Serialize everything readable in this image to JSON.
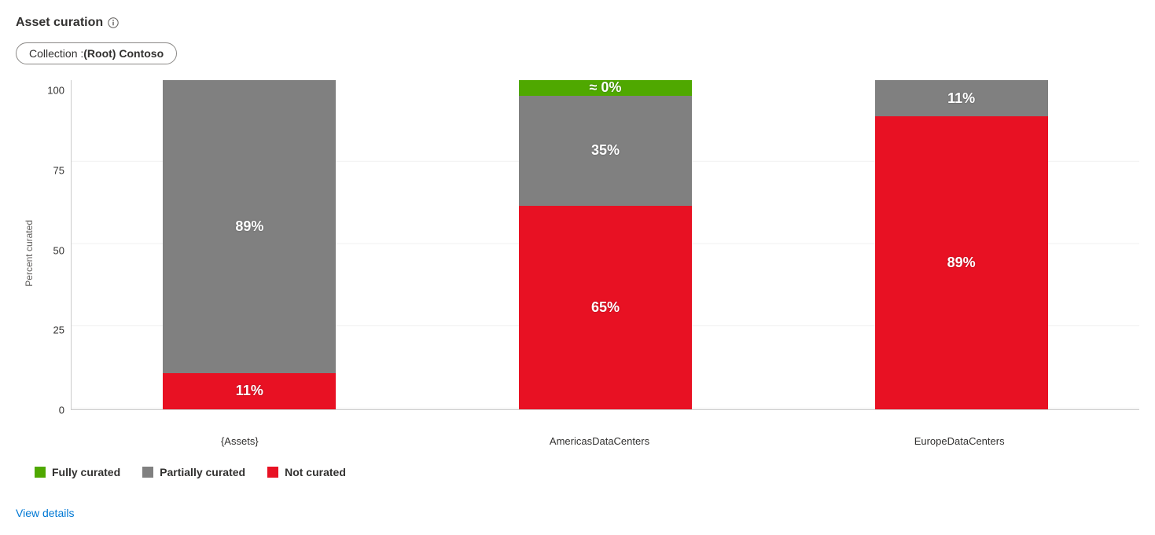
{
  "header": {
    "title": "Asset curation"
  },
  "filter": {
    "label": "Collection : ",
    "value": "(Root) Contoso"
  },
  "chart_data": {
    "type": "bar",
    "stacked": true,
    "ylabel": "Percent curated",
    "ylim": [
      0,
      100
    ],
    "yticks": [
      0,
      25,
      50,
      75,
      100
    ],
    "categories": [
      "{Assets}",
      "AmericasDataCenters",
      "EuropeDataCenters"
    ],
    "series": [
      {
        "name": "Fully curated",
        "color": "#4fa800",
        "values": [
          0,
          0.1,
          0
        ],
        "labels": [
          "",
          "≈ 0%",
          ""
        ]
      },
      {
        "name": "Partially curated",
        "color": "#808080",
        "values": [
          89,
          35,
          11
        ],
        "labels": [
          "89%",
          "35%",
          "11%"
        ]
      },
      {
        "name": "Not curated",
        "color": "#e81123",
        "values": [
          11,
          65,
          89
        ],
        "labels": [
          "11%",
          "65%",
          "89%"
        ]
      }
    ]
  },
  "legend": {
    "fully": "Fully curated",
    "partially": "Partially curated",
    "not": "Not curated"
  },
  "footer": {
    "view_details": "View details"
  }
}
